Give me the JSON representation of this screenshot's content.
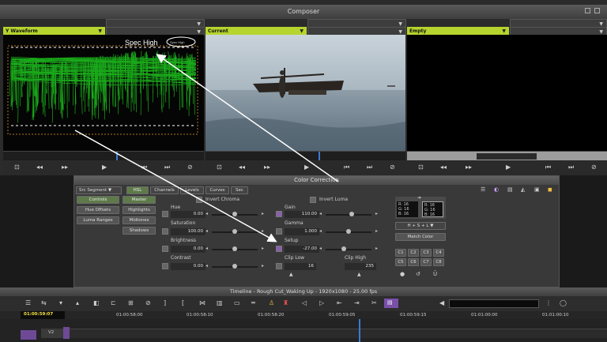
{
  "composer": {
    "title": "Composer",
    "left_source": "Y Waveform",
    "center_source": "Current",
    "right_source": "Empty",
    "spec_high_label": "Spec High",
    "spec_high_box": "Spec High"
  },
  "color_correction": {
    "title": "Color Correction",
    "segment_mode": "Src Segment",
    "top_tabs": [
      "HSL",
      "Channels",
      "Levels",
      "Curves",
      "Sec"
    ],
    "left_buttons": [
      "Controls",
      "Hue Offsets",
      "Luma Ranges"
    ],
    "group_buttons": [
      "Master",
      "Highlights",
      "Midtones",
      "Shadows"
    ],
    "invert_chroma": "Invert Chroma",
    "invert_luma": "Invert Luma",
    "hue_label": "Hue",
    "hue_value": "0.00",
    "saturation_label": "Saturation",
    "saturation_value": "100.00",
    "brightness_label": "Brightness",
    "brightness_value": "0.00",
    "contrast_label": "Contrast",
    "contrast_value": "0.00",
    "gain_label": "Gain",
    "gain_value": "110.00",
    "gamma_label": "Gamma",
    "gamma_value": "1.000",
    "setup_label": "Setup",
    "setup_value": "-27.00",
    "clip_low_label": "Clip Low",
    "clip_low_value": "16",
    "clip_high_label": "Clip High",
    "clip_high_value": "235",
    "rgb_left": [
      "R: 16",
      "G: 16",
      "B: 16"
    ],
    "rgb_right": [
      "R: 16",
      "G: 16",
      "B: 16"
    ],
    "hsl_dropdown": "H + S + L",
    "match_color": "Match Color",
    "slots": [
      "C1",
      "C2",
      "C3",
      "C4",
      "C5",
      "C6",
      "C7",
      "C8"
    ]
  },
  "timeline": {
    "title": "Timeline - Rough Cut_Waking Up - 1920x1080 - 25.00 fps",
    "timecode": "01:00:59:07",
    "ruler": [
      "01:00:58:00",
      "01:00:58:10",
      "01:00:58:20",
      "01:00:59:05",
      "01:00:59:15",
      "01:01:00:00",
      "01:01:00:10"
    ],
    "track_label": "V2"
  },
  "colors": {
    "waveform_green": "#22e022",
    "source_green": "#b6d42e",
    "selected_button": "#5e7a4a"
  }
}
